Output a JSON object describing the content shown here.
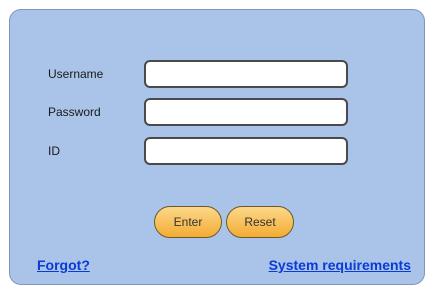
{
  "login_form": {
    "username": {
      "label": "Username",
      "value": ""
    },
    "password": {
      "label": "Password",
      "value": ""
    },
    "id": {
      "label": "ID",
      "value": ""
    },
    "buttons": {
      "enter": "Enter",
      "reset": "Reset"
    },
    "links": {
      "forgot": "Forgot?",
      "system_requirements": "System requirements"
    }
  },
  "colors": {
    "panel_background": "#a9c4e8",
    "button_gradient_top": "#fbd88a",
    "button_gradient_bottom": "#f4ac33",
    "link": "#0b3ad6"
  }
}
